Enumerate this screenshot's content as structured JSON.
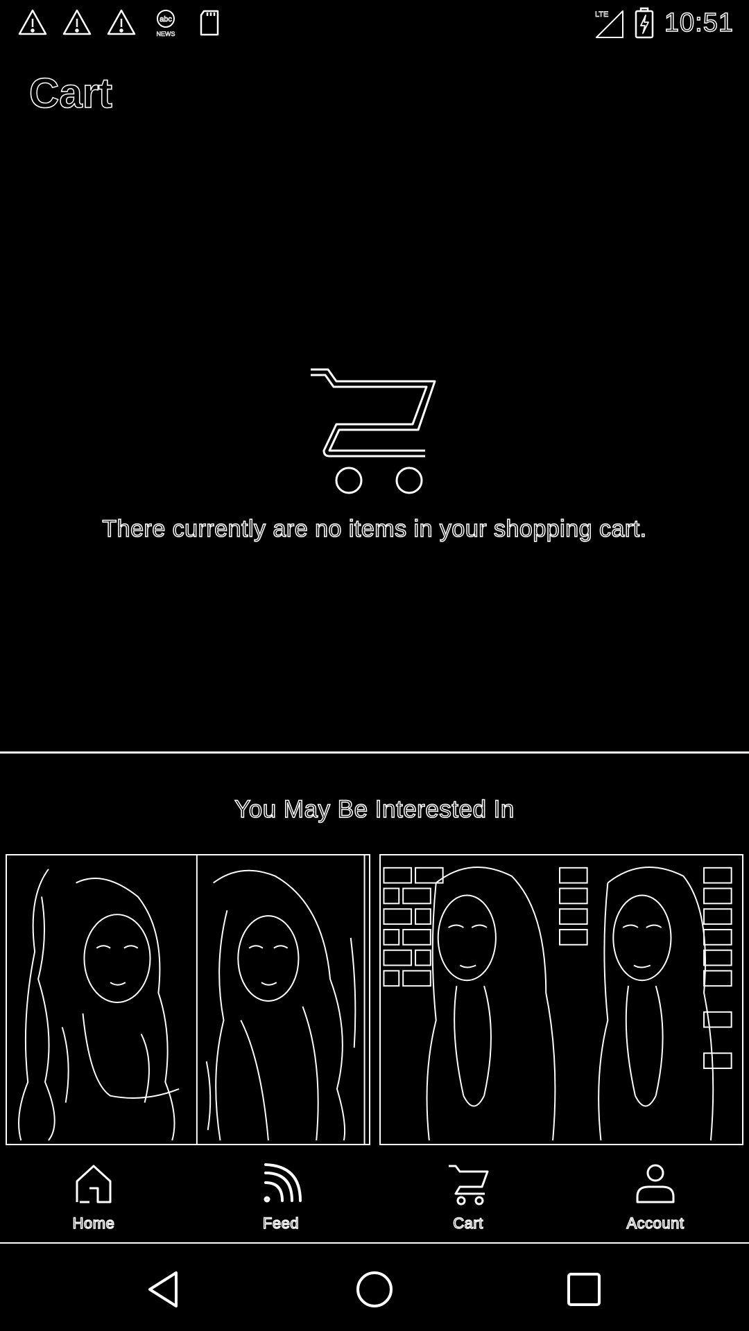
{
  "status_bar": {
    "time": "10:51",
    "icons": [
      "warning-icon",
      "warning-icon",
      "warning-icon",
      "abc-news-icon",
      "sd-card-icon",
      "lte-signal-icon",
      "battery-charging-icon"
    ]
  },
  "page": {
    "title": "Cart"
  },
  "empty_state": {
    "icon": "shopping-cart-icon",
    "message": "There currently are no items in your shopping cart."
  },
  "recommendations": {
    "heading": "You May Be Interested In",
    "products": [
      {
        "image": "product-image-two-curly-hair-women"
      },
      {
        "image": "product-image-two-long-hair-women-brick-wall"
      }
    ]
  },
  "bottom_nav": {
    "items": [
      {
        "label": "Home",
        "icon": "home-icon"
      },
      {
        "label": "Feed",
        "icon": "feed-icon"
      },
      {
        "label": "Cart",
        "icon": "cart-icon"
      },
      {
        "label": "Account",
        "icon": "account-icon"
      }
    ]
  },
  "system_nav": {
    "buttons": [
      "back-icon",
      "home-circle-icon",
      "recents-icon"
    ]
  },
  "colors": {
    "background": "#000000",
    "foreground": "#ffffff"
  }
}
